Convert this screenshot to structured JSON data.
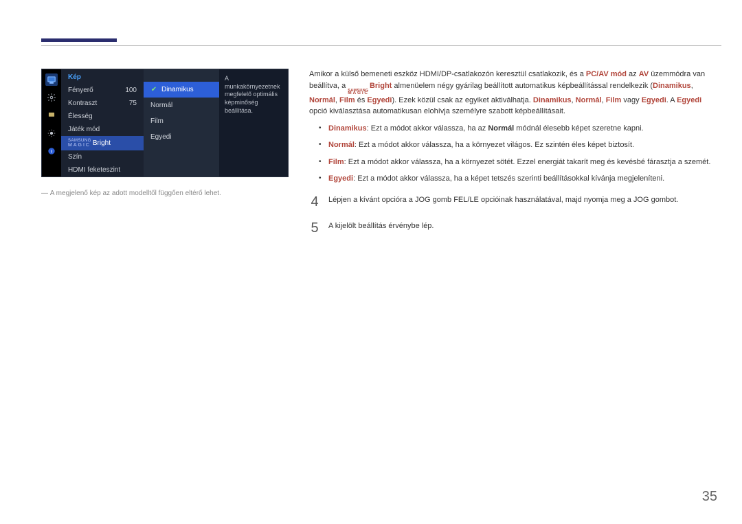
{
  "page_number": "35",
  "osd": {
    "title": "Kép",
    "items": [
      {
        "label": "Fényerő",
        "value": "100"
      },
      {
        "label": "Kontraszt",
        "value": "75"
      },
      {
        "label": "Élesség",
        "value": ""
      },
      {
        "label": "Játék mód",
        "value": ""
      },
      {
        "label_brand": {
          "samsung": "SAMSUNG",
          "magic": "MAGIC",
          "bright": "Bright"
        }
      },
      {
        "label": "Szín",
        "value": ""
      },
      {
        "label": "HDMI feketeszint",
        "value": ""
      }
    ],
    "submenu": [
      {
        "label": "Dinamikus",
        "selected": true
      },
      {
        "label": "Normál",
        "selected": false
      },
      {
        "label": "Film",
        "selected": false
      },
      {
        "label": "Egyedi",
        "selected": false
      }
    ],
    "desc": "A munkakörnyezetnek megfelelő optimális képminőség beállítása."
  },
  "caption": "A megjelenő kép az adott modelltől függően eltérő lehet.",
  "right": {
    "para_pre": "Amikor a külső bemeneti eszköz HDMI/DP-csatlakozón keresztül csatlakozik, és a ",
    "para_pcav": "PC/AV mód",
    "para_mid1": " az ",
    "para_av": "AV",
    "para_mid2": " üzemmódra van beállítva, a ",
    "brand_samsung": "SAMSUNG",
    "brand_magic": "MAGIC",
    "para_bright": "Bright",
    "para_mid3": " almenüelem négy gyárilag beállított automatikus képbeállítással rendelkezik (",
    "para_d": "Dinamikus",
    "para_n": "Normál",
    "para_f": "Film",
    "para_e": "Egyedi",
    "para_mid4": "). Ezek közül csak az egyiket aktiválhatja. ",
    "para_list_sep1": ", ",
    "para_list_sep2": " vagy ",
    "para_post": ". A ",
    "para_post2": " opció kiválasztása automatikusan elohívja személyre szabott képbeállításait.",
    "bullets": [
      {
        "head": "Dinamikus",
        "text": ": Ezt a módot akkor válassza, ha az ",
        "bold_in": "Normál",
        "tail": " módnál élesebb képet szeretne kapni."
      },
      {
        "head": "Normál",
        "text": ": Ezt a módot akkor válassza, ha a környezet világos. Ez szintén éles képet biztosít.",
        "bold_in": "",
        "tail": ""
      },
      {
        "head": "Film",
        "text": ": Ezt a módot akkor válassza, ha a környezet sötét. Ezzel energiát takarít meg és kevésbé fárasztja a szemét.",
        "bold_in": "",
        "tail": ""
      },
      {
        "head": "Egyedi",
        "text": ": Ezt a módot akkor válassza, ha a képet tetszés szerinti beállításokkal kívánja megjeleníteni.",
        "bold_in": "",
        "tail": ""
      }
    ],
    "step4_num": "4",
    "step4_text": "Lépjen a kívánt opcióra a JOG gomb FEL/LE opcióinak használatával, majd nyomja meg a JOG gombot.",
    "step5_num": "5",
    "step5_text": "A kijelölt beállítás érvénybe lép."
  }
}
